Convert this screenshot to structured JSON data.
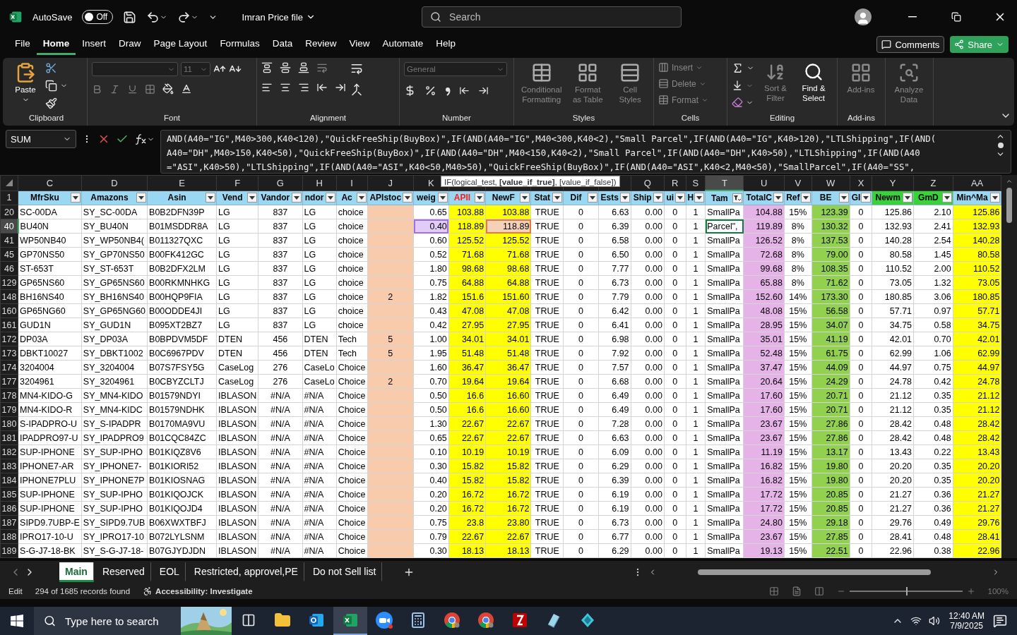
{
  "title_bar": {
    "autosave_label": "AutoSave",
    "autosave_on": false,
    "autosave_state": "Off",
    "file_name": "Imran Price file",
    "search_placeholder": "Search"
  },
  "menu_tabs": [
    {
      "label": "File",
      "selected": false
    },
    {
      "label": "Home",
      "selected": true
    },
    {
      "label": "Insert",
      "selected": false
    },
    {
      "label": "Draw",
      "selected": false
    },
    {
      "label": "Page Layout",
      "selected": false
    },
    {
      "label": "Formulas",
      "selected": false
    },
    {
      "label": "Data",
      "selected": false
    },
    {
      "label": "Review",
      "selected": false
    },
    {
      "label": "View",
      "selected": false
    },
    {
      "label": "Automate",
      "selected": false
    },
    {
      "label": "Help",
      "selected": false
    }
  ],
  "comments_button": "Comments",
  "share_button": "Share",
  "ribbon": {
    "paste": "Paste",
    "font_size": "11",
    "number_format": "General",
    "styles": [
      {
        "label": "Conditional Formatting",
        "disabled": true
      },
      {
        "label": "Format as Table",
        "disabled": true
      },
      {
        "label": "Cell Styles",
        "disabled": true
      }
    ],
    "cells": [
      {
        "label": "Insert",
        "disabled": true
      },
      {
        "label": "Delete",
        "disabled": true
      },
      {
        "label": "Format",
        "disabled": true
      }
    ],
    "editing": [
      {
        "label": "Sort & Filter",
        "disabled": true
      },
      {
        "label": "Find & Select",
        "disabled": false
      }
    ],
    "addins": [
      {
        "label": "Add-ins",
        "disabled": true
      },
      {
        "label": "Analyze Data",
        "disabled": true
      }
    ],
    "group_labels": [
      "Clipboard",
      "Font",
      "Alignment",
      "Number",
      "Styles",
      "Cells",
      "Editing",
      "Add-ins"
    ]
  },
  "formula_bar": {
    "name_box": "SUM",
    "lines": [
      "AND(A40=\"IG\",M40>300,K40<120),\"QuickFreeShip(BuyBox)\",IF(AND(A40=\"IG\",M40<300,K40<2),\"Small Parcel\",IF(AND(A40=\"IG\",K40>120),\"LTLShipping\",IF(AND(",
      "A40=\"DH\",M40>150,K40<50),\"QuickFreeShip(BuyBox)\",IF(AND(A40=\"DH\",M40<150,K40<2),\"Small Parcel\",IF(AND(A40=\"DH\",K40>50),\"LTLShipping\",IF(AND(A40",
      "=\"ASI\",K40>50),\"LTLShipping\",IF(AND(A40=\"ASI\",K40<50,M40>50),\"QuickFreeShip(BuyBox)\",IF(AND(A40=\"ASI\",K40<2,M40<50),\"SmallParcel\",IF(A40=\"SS\","
    ]
  },
  "tooltip": "IF(logical_test, **[value_if_true]**, [value_if_false])",
  "header_row_number": "1",
  "columns": [
    {
      "letter": "C",
      "header": "MfrSku",
      "selected": false,
      "filtered": false
    },
    {
      "letter": "D",
      "header": "Amazons",
      "selected": false,
      "filtered": false
    },
    {
      "letter": "E",
      "header": "Asin",
      "selected": false,
      "filtered": false
    },
    {
      "letter": "F",
      "header": "Vend",
      "selected": false,
      "filtered": false
    },
    {
      "letter": "G",
      "header": "Vandor",
      "selected": false,
      "filtered": false
    },
    {
      "letter": "H",
      "header": "ndor",
      "selected": false,
      "filtered": false
    },
    {
      "letter": "I",
      "header": "Ac",
      "selected": false,
      "filtered": false
    },
    {
      "letter": "J",
      "header": "APIstoc",
      "color": "#f8cbad",
      "selected": false,
      "filtered": false
    },
    {
      "letter": "K",
      "header": "weig",
      "selected": false,
      "filtered": false
    },
    {
      "header": "APII",
      "kind": "alert",
      "color": "#ffff00",
      "selected": false,
      "filtered": false
    },
    {
      "header": "NewF",
      "color": "#ffff00",
      "selected": false,
      "filtered": false
    },
    {
      "header": "Stat",
      "selected": false,
      "filtered": false
    },
    {
      "header": "Dif",
      "selected": false,
      "filtered": false
    },
    {
      "header": "Ests",
      "selected": false,
      "filtered": false
    },
    {
      "letter": "Q",
      "header": "Ship",
      "selected": false,
      "filtered": false
    },
    {
      "letter": "R",
      "header": "ui",
      "selected": false,
      "filtered": false
    },
    {
      "letter": "S",
      "header": "H",
      "selected": false,
      "filtered": false
    },
    {
      "letter": "T",
      "header": "Tam",
      "selected": true,
      "filtered": true
    },
    {
      "letter": "U",
      "header": "TotalC",
      "color": "#e6b3e8",
      "selected": false,
      "filtered": false
    },
    {
      "letter": "V",
      "header": "Ref",
      "selected": false,
      "filtered": false
    },
    {
      "letter": "W",
      "header": "BE",
      "color": "#92d050",
      "selected": false,
      "filtered": false
    },
    {
      "letter": "X",
      "header": "GI",
      "selected": false,
      "filtered": false
    },
    {
      "letter": "Y",
      "header": "Newm",
      "kind": "highlight",
      "selected": false,
      "filtered": false
    },
    {
      "letter": "Z",
      "header": "GmD",
      "kind": "highlight",
      "selected": false,
      "filtered": false
    },
    {
      "letter": "AA",
      "header": "Min^Ma",
      "color": "#ffff00",
      "selected": false,
      "filtered": false
    }
  ],
  "rows": [
    {
      "number": "20",
      "selected": false,
      "cells": [
        "SC-00DA",
        "SY_SC-00DA",
        "B0B2DFN39P",
        "LG",
        "837",
        "LG",
        "choice",
        null,
        "0.65",
        "103.88",
        "103.88",
        "TRUE",
        "0",
        "6.63",
        "0.00",
        "0",
        "1",
        "SmallPa",
        "104.88",
        "15%",
        "123.39",
        "0",
        "125.86",
        "2.10",
        "125.86"
      ]
    },
    {
      "number": "40",
      "selected": true,
      "cells": [
        "BU40N",
        "SY_BU40N",
        "B01MSDDR8A",
        "LG",
        "837",
        "LG",
        "choice",
        null,
        {
          "text": "0.40",
          "color": "#a56ee6"
        },
        "118.89",
        {
          "text": "118.89",
          "color": "#e47b3a"
        },
        "TRUE",
        "0",
        "6.39",
        "0.00",
        "0",
        "1",
        {
          "text": "Parcel\",",
          "active": true
        },
        "119.89",
        "8%",
        "130.32",
        "0",
        "132.93",
        "2.41",
        "132.93"
      ]
    },
    {
      "number": "41",
      "selected": false,
      "cells": [
        "WP50NB40",
        "SY_WP50NB4(",
        "B011327QXC",
        "LG",
        "837",
        "LG",
        "choice",
        null,
        "0.60",
        "125.52",
        "125.52",
        "TRUE",
        "0",
        "6.58",
        "0.00",
        "0",
        "1",
        "SmallPa",
        "126.52",
        "8%",
        "137.53",
        "0",
        "140.28",
        "2.54",
        "140.28"
      ]
    },
    {
      "number": "45",
      "selected": false,
      "cells": [
        "GP70NS50",
        "SY_GP70NS50",
        "B00FK412GC",
        "LG",
        "837",
        "LG",
        "choice",
        null,
        "0.52",
        "71.68",
        "71.68",
        "TRUE",
        "0",
        "6.50",
        "0.00",
        "0",
        "1",
        "SmallPa",
        "72.68",
        "8%",
        "79.00",
        "0",
        "80.58",
        "1.45",
        "80.58"
      ]
    },
    {
      "number": "46",
      "selected": false,
      "cells": [
        "ST-653T",
        "SY_ST-653T",
        "B0B2DFX2LM",
        "LG",
        "837",
        "LG",
        "choice",
        null,
        "1.80",
        "98.68",
        "98.68",
        "TRUE",
        "0",
        "7.77",
        "0.00",
        "0",
        "1",
        "SmallPa",
        "99.68",
        "8%",
        "108.35",
        "0",
        "110.52",
        "2.00",
        "110.52"
      ]
    },
    {
      "number": "129",
      "selected": false,
      "cells": [
        "GP65NS60",
        "SY_GP65NS60",
        "B00RKMNHKG",
        "LG",
        "837",
        "LG",
        "choice",
        null,
        "0.75",
        "64.88",
        "64.88",
        "TRUE",
        "0",
        "6.73",
        "0.00",
        "0",
        "1",
        "SmallPa",
        "65.88",
        "8%",
        "71.62",
        "0",
        "73.05",
        "1.32",
        "73.05"
      ]
    },
    {
      "number": "148",
      "selected": false,
      "cells": [
        "BH16NS40",
        "SY_BH16NS40",
        "B00HQP9FIA",
        "LG",
        "837",
        "LG",
        "choice",
        "2",
        "1.82",
        "151.6",
        "151.60",
        "TRUE",
        "0",
        "7.79",
        "0.00",
        "0",
        "1",
        "SmallPa",
        "152.60",
        "14%",
        "173.30",
        "0",
        "180.85",
        "3.06",
        "180.85"
      ]
    },
    {
      "number": "160",
      "selected": false,
      "cells": [
        "GP65NG60",
        "SY_GP65NG60",
        "B00ODDE4JI",
        "LG",
        "837",
        "LG",
        "choice",
        null,
        "0.43",
        "47.08",
        "47.08",
        "TRUE",
        "0",
        "6.42",
        "0.00",
        "0",
        "1",
        "SmallPa",
        "48.08",
        "15%",
        "56.58",
        "0",
        "57.71",
        "0.97",
        "57.71"
      ]
    },
    {
      "number": "161",
      "selected": false,
      "cells": [
        "GUD1N",
        "SY_GUD1N",
        "B095XT2BZ7",
        "LG",
        "837",
        "LG",
        "choice",
        null,
        "0.42",
        "27.95",
        "27.95",
        "TRUE",
        "0",
        "6.41",
        "0.00",
        "0",
        "1",
        "SmallPa",
        "28.95",
        "15%",
        "34.07",
        "0",
        "34.75",
        "0.58",
        "34.75"
      ]
    },
    {
      "number": "172",
      "selected": false,
      "cells": [
        "DP03A",
        "SY_DP03A",
        "B0BPDVM5DF",
        "DTEN",
        "456",
        "DTEN",
        "Tech",
        "5",
        "1.00",
        "34.01",
        "34.01",
        "TRUE",
        "0",
        "6.98",
        "0.00",
        "0",
        "1",
        "SmallPa",
        "35.01",
        "15%",
        "41.19",
        "0",
        "42.01",
        "0.70",
        "42.01"
      ]
    },
    {
      "number": "173",
      "selected": false,
      "cells": [
        "DBKT10027",
        "SY_DBKT1002",
        "B0C6967PDV",
        "DTEN",
        "456",
        "DTEN",
        "Tech",
        "5",
        "1.95",
        "51.48",
        "51.48",
        "TRUE",
        "0",
        "7.92",
        "0.00",
        "0",
        "1",
        "SmallPa",
        "52.48",
        "15%",
        "61.75",
        "0",
        "62.99",
        "1.06",
        "62.99"
      ]
    },
    {
      "number": "174",
      "selected": false,
      "cells": [
        "3204004",
        "SY_3204004",
        "B07S7FSY5G",
        "CaseLog",
        "276",
        "CaseLo",
        "Choice",
        null,
        "1.60",
        "36.47",
        "36.47",
        "TRUE",
        "0",
        "7.57",
        "0.00",
        "0",
        "1",
        "SmallPa",
        "37.47",
        "15%",
        "44.09",
        "0",
        "44.97",
        "0.75",
        "44.97"
      ]
    },
    {
      "number": "177",
      "selected": false,
      "cells": [
        "3204961",
        "SY_3204961",
        "B0CBYZCLTJ",
        "CaseLog",
        "276",
        "CaseLo",
        "Choice",
        "2",
        "0.70",
        "19.64",
        "19.64",
        "TRUE",
        "0",
        "6.68",
        "0.00",
        "0",
        "1",
        "SmallPa",
        "20.64",
        "15%",
        "24.29",
        "0",
        "24.78",
        "0.42",
        "24.78"
      ]
    },
    {
      "number": "178",
      "selected": false,
      "cells": [
        "MN4-KIDO-G",
        "SY_MN4-KIDO",
        "B01579NDYI",
        "IBLASON",
        "#N/A",
        "#N/A",
        "Choice",
        null,
        "0.50",
        "16.6",
        "16.60",
        "TRUE",
        "0",
        "6.49",
        "0.00",
        "0",
        "1",
        "SmallPa",
        "17.60",
        "15%",
        "20.71",
        "0",
        "21.12",
        "0.35",
        "21.12"
      ]
    },
    {
      "number": "179",
      "selected": false,
      "cells": [
        "MN4-KIDO-R",
        "SY_MN4-KIDC",
        "B01579NDHK",
        "IBLASON",
        "#N/A",
        "#N/A",
        "Choice",
        null,
        "0.50",
        "16.6",
        "16.60",
        "TRUE",
        "0",
        "6.49",
        "0.00",
        "0",
        "1",
        "SmallPa",
        "17.60",
        "15%",
        "20.71",
        "0",
        "21.12",
        "0.35",
        "21.12"
      ]
    },
    {
      "number": "180",
      "selected": false,
      "cells": [
        "S-IPADPRO-U",
        "SY_S-IPADPR",
        "B0170MA9VU",
        "IBLASON",
        "#N/A",
        "#N/A",
        "Choice",
        null,
        "1.30",
        "22.67",
        "22.67",
        "TRUE",
        "0",
        "7.28",
        "0.00",
        "0",
        "1",
        "SmallPa",
        "23.67",
        "15%",
        "27.86",
        "0",
        "28.42",
        "0.48",
        "28.42"
      ]
    },
    {
      "number": "181",
      "selected": false,
      "cells": [
        "IPADPRO97-U",
        "SY_IPADPRO9",
        "B01CQC84ZC",
        "IBLASON",
        "#N/A",
        "#N/A",
        "Choice",
        null,
        "0.65",
        "22.67",
        "22.67",
        "TRUE",
        "0",
        "6.63",
        "0.00",
        "0",
        "1",
        "SmallPa",
        "23.67",
        "15%",
        "27.86",
        "0",
        "28.42",
        "0.48",
        "28.42"
      ]
    },
    {
      "number": "182",
      "selected": false,
      "cells": [
        "SUP-IPHONE",
        "SY_SUP-IPHO",
        "B01KIQZ8V6",
        "IBLASON",
        "#N/A",
        "#N/A",
        "Choice",
        null,
        "0.10",
        "10.19",
        "10.19",
        "TRUE",
        "0",
        "6.09",
        "0.00",
        "0",
        "1",
        "SmallPa",
        "11.19",
        "15%",
        "13.17",
        "0",
        "13.43",
        "0.22",
        "13.43"
      ]
    },
    {
      "number": "183",
      "selected": false,
      "cells": [
        "IPHONE7-AR",
        "SY_IPHONE7-",
        "B01KIORI52",
        "IBLASON",
        "#N/A",
        "#N/A",
        "Choice",
        null,
        "0.30",
        "15.82",
        "15.82",
        "TRUE",
        "0",
        "6.29",
        "0.00",
        "0",
        "1",
        "SmallPa",
        "16.82",
        "15%",
        "19.80",
        "0",
        "20.20",
        "0.35",
        "20.20"
      ]
    },
    {
      "number": "184",
      "selected": false,
      "cells": [
        "IPHONE7PLU",
        "SY_IPHONE7P",
        "B01KIOSNAG",
        "IBLASON",
        "#N/A",
        "#N/A",
        "Choice",
        null,
        "0.40",
        "15.82",
        "15.82",
        "TRUE",
        "0",
        "6.39",
        "0.00",
        "0",
        "1",
        "SmallPa",
        "16.82",
        "15%",
        "19.80",
        "0",
        "20.20",
        "0.35",
        "20.20"
      ]
    },
    {
      "number": "185",
      "selected": false,
      "cells": [
        "SUP-IPHONE",
        "SY_SUP-IPHO",
        "B01KIQOJCK",
        "IBLASON",
        "#N/A",
        "#N/A",
        "Choice",
        null,
        "0.20",
        "16.72",
        "16.72",
        "TRUE",
        "0",
        "6.19",
        "0.00",
        "0",
        "1",
        "SmallPa",
        "17.72",
        "15%",
        "20.85",
        "0",
        "21.27",
        "0.36",
        "21.27"
      ]
    },
    {
      "number": "186",
      "selected": false,
      "cells": [
        "SUP-IPHONE",
        "SY_SUP-IPHO",
        "B01KIQOJD4",
        "IBLASON",
        "#N/A",
        "#N/A",
        "Choice",
        null,
        "0.20",
        "16.72",
        "16.72",
        "TRUE",
        "0",
        "6.19",
        "0.00",
        "0",
        "1",
        "SmallPa",
        "17.72",
        "15%",
        "20.85",
        "0",
        "21.27",
        "0.36",
        "21.27"
      ]
    },
    {
      "number": "187",
      "selected": false,
      "cells": [
        "SIPD9.7UBP-E",
        "SY_SIPD9.7UB",
        "B06XWXTBFJ",
        "IBLASON",
        "#N/A",
        "#N/A",
        "Choice",
        null,
        "0.75",
        "23.8",
        "23.80",
        "TRUE",
        "0",
        "6.73",
        "0.00",
        "0",
        "1",
        "SmallPa",
        "24.80",
        "15%",
        "29.18",
        "0",
        "29.76",
        "0.49",
        "29.76"
      ]
    },
    {
      "number": "188",
      "selected": false,
      "cells": [
        "IPRO17-10-U",
        "SY_IPRO17-10",
        "B072LYLSNM",
        "IBLASON",
        "#N/A",
        "#N/A",
        "Choice",
        null,
        "0.79",
        "22.67",
        "22.67",
        "TRUE",
        "0",
        "6.77",
        "0.00",
        "0",
        "1",
        "SmallPa",
        "23.67",
        "15%",
        "27.85",
        "0",
        "28.41",
        "0.48",
        "28.41"
      ]
    },
    {
      "number": "189",
      "selected": false,
      "cells": [
        "S-G-J7-18-BK",
        "SY_S-G-J7-18-",
        "B07GJYDJDN",
        "IBLASON",
        "#N/A",
        "#N/A",
        "Choice",
        null,
        "0.30",
        "18.13",
        "18.13",
        "TRUE",
        "0",
        "6.29",
        "0.00",
        "0",
        "1",
        "SmallPa",
        "19.13",
        "15%",
        "22.51",
        "0",
        "22.96",
        "0.38",
        "22.96"
      ]
    }
  ],
  "sheet_tabs": [
    {
      "label": "Main",
      "selected": true
    },
    {
      "label": "Reserved",
      "selected": false
    },
    {
      "label": "EOL",
      "selected": false
    },
    {
      "label": "Restricted, approvel,PE",
      "selected": false
    },
    {
      "label": "Do not Sell list",
      "selected": false
    }
  ],
  "status_bar": {
    "mode": "Edit",
    "records": "294 of 1685 records found",
    "accessibility": "Accessibility: Investigate",
    "zoom": "100%",
    "level": 0.5
  },
  "taskbar": {
    "search_placeholder": "Type here to search",
    "time": "12:40 AM",
    "date": "7/9/2025",
    "apps": [
      {
        "kind": "taskview",
        "selected": false
      },
      {
        "kind": "folder",
        "selected": false
      },
      {
        "kind": "outlook",
        "selected": false
      },
      {
        "kind": "excel",
        "selected": true
      },
      {
        "kind": "zoom",
        "selected": false
      },
      {
        "kind": "calculator",
        "selected": false
      },
      {
        "kind": "chrome",
        "selected": false
      },
      {
        "kind": "chrome",
        "selected": false
      },
      {
        "kind": "filezilla",
        "selected": false
      },
      {
        "kind": "notes",
        "selected": false
      },
      {
        "kind": "gem",
        "selected": false
      }
    ]
  }
}
